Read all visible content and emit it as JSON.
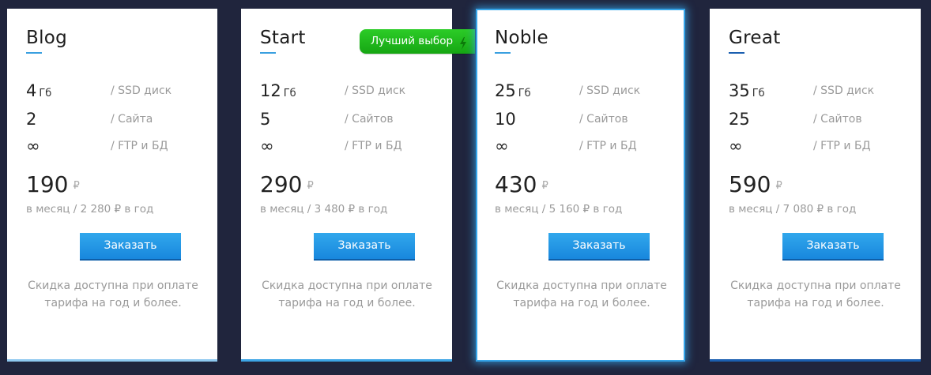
{
  "badge": {
    "label": "Лучший выбор",
    "icon": "lightning-bolt-icon",
    "color": "#22b31e"
  },
  "accent_color": "#2a9be8",
  "plans": [
    {
      "name": "Blog",
      "disk": {
        "value": "4",
        "unit": "Гб",
        "label": "/ SSD диск"
      },
      "sites": {
        "value": "2",
        "label": "/ Сайта"
      },
      "ftp": {
        "value": "∞",
        "label": "/ FTP и БД"
      },
      "price": "190",
      "currency": "₽",
      "period": "в месяц / 2 280 ₽ в год",
      "button": "Заказать",
      "note": "Скидка доступна при оплате тарифа на год и более."
    },
    {
      "name": "Start",
      "disk": {
        "value": "12",
        "unit": "Гб",
        "label": "/ SSD диск"
      },
      "sites": {
        "value": "5",
        "label": "/ Сайтов"
      },
      "ftp": {
        "value": "∞",
        "label": "/ FTP и БД"
      },
      "price": "290",
      "currency": "₽",
      "period": "в месяц / 3 480 ₽ в год",
      "button": "Заказать",
      "note": "Скидка доступна при оплате тарифа на год и более."
    },
    {
      "name": "Noble",
      "disk": {
        "value": "25",
        "unit": "Гб",
        "label": "/ SSD диск"
      },
      "sites": {
        "value": "10",
        "label": "/ Сайтов"
      },
      "ftp": {
        "value": "∞",
        "label": "/ FTP и БД"
      },
      "price": "430",
      "currency": "₽",
      "period": "в месяц / 5 160 ₽ в год",
      "button": "Заказать",
      "note": "Скидка доступна при оплате тарифа на год и более."
    },
    {
      "name": "Great",
      "disk": {
        "value": "35",
        "unit": "Гб",
        "label": "/ SSD диск"
      },
      "sites": {
        "value": "25",
        "label": "/ Сайтов"
      },
      "ftp": {
        "value": "∞",
        "label": "/ FTP и БД"
      },
      "price": "590",
      "currency": "₽",
      "period": "в месяц / 7 080 ₽ в год",
      "button": "Заказать",
      "note": "Скидка доступна при оплате тарифа на год и более."
    }
  ]
}
